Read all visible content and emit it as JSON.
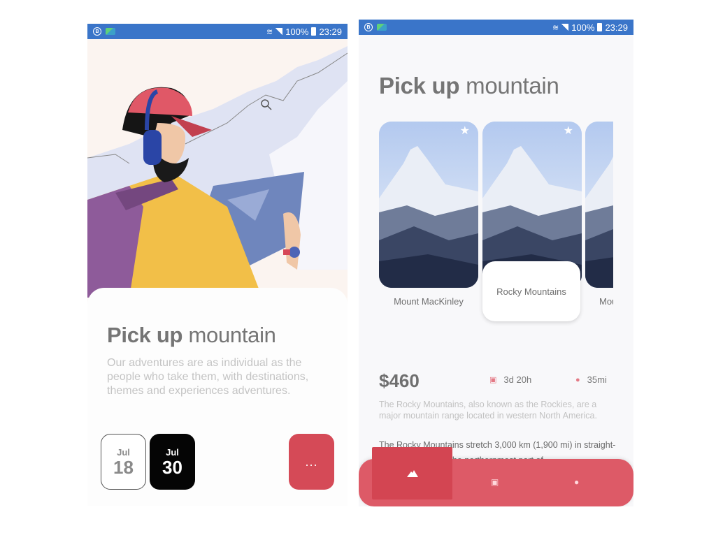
{
  "status_bar": {
    "battery": "100%",
    "time": "23:29",
    "left_icons": [
      "b-circle-icon",
      "messages-icon"
    ],
    "right_icons": [
      "wifi-icon",
      "signal-icon",
      "battery-icon"
    ]
  },
  "screen1": {
    "title_bold": "Pick up",
    "title_light": "mountain",
    "description": "Our adventures are as individual as the people who take them, with destinations, themes and experiences adventures.",
    "dates": [
      {
        "month": "Jul",
        "day": "18",
        "selected": false
      },
      {
        "month": "Jul",
        "day": "30",
        "selected": true
      }
    ],
    "more_button": "..."
  },
  "screen2": {
    "title_bold": "Pick up",
    "title_light": "mountain",
    "cards": [
      {
        "name": "Mount MacKinley"
      },
      {
        "name": "Rocky Mountains"
      },
      {
        "name": "Mou"
      }
    ],
    "price": "$460",
    "duration": "3d 20h",
    "distance": "35mi",
    "description": "The Rocky Mountains, also known as the Rockies, are a major mountain range located in western North America.",
    "description2": "The Rocky Mountains stretch 3,000 km (1,900 mi) in straight-line distance from the northernmost part of",
    "nav": [
      {
        "icon": "mountain-icon",
        "active": true
      },
      {
        "icon": "bus-icon",
        "active": false
      },
      {
        "icon": "chat-icon",
        "active": false
      }
    ]
  },
  "colors": {
    "accent": "#d54a57",
    "status_bar": "#3a75c9",
    "nav": "#dd5a67"
  }
}
